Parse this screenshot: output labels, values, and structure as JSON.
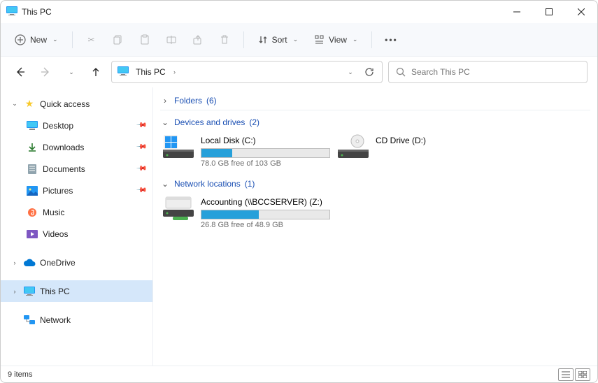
{
  "window": {
    "title": "This PC"
  },
  "toolbar": {
    "new_label": "New",
    "sort_label": "Sort",
    "view_label": "View"
  },
  "address": {
    "crumb": "This PC"
  },
  "search": {
    "placeholder": "Search This PC"
  },
  "sidebar": {
    "quick_access": "Quick access",
    "items": {
      "desktop": "Desktop",
      "downloads": "Downloads",
      "documents": "Documents",
      "pictures": "Pictures",
      "music": "Music",
      "videos": "Videos"
    },
    "onedrive": "OneDrive",
    "this_pc": "This PC",
    "network": "Network"
  },
  "groups": {
    "folders": {
      "label": "Folders",
      "count": "(6)"
    },
    "devices": {
      "label": "Devices and drives",
      "count": "(2)",
      "local_disk": {
        "name": "Local Disk (C:)",
        "free": "78.0 GB free of 103 GB",
        "fill_pct": 24
      },
      "cd_drive": {
        "name": "CD Drive (D:)"
      }
    },
    "network": {
      "label": "Network locations",
      "count": "(1)",
      "accounting": {
        "name": "Accounting (\\\\BCCSERVER) (Z:)",
        "free": "26.8 GB free of 48.9 GB",
        "fill_pct": 45
      }
    }
  },
  "status": {
    "count": "9 items"
  }
}
